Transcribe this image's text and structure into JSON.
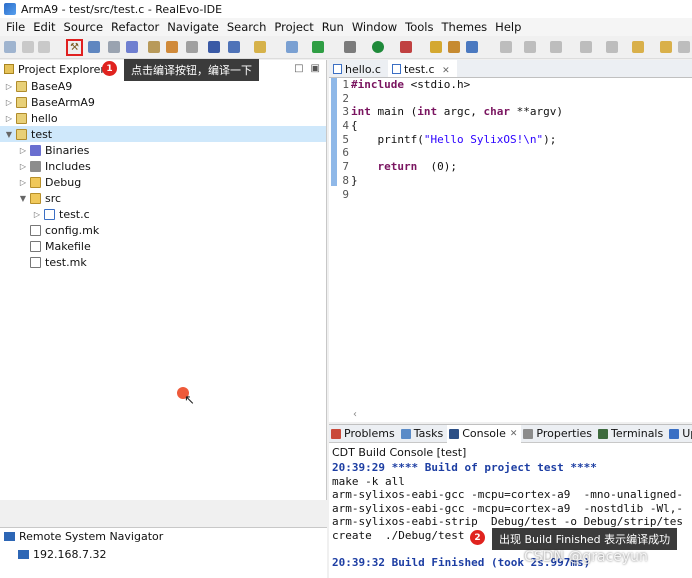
{
  "window": {
    "title": "ArmA9 - test/src/test.c - RealEvo-IDE"
  },
  "menu": [
    "File",
    "Edit",
    "Source",
    "Refactor",
    "Navigate",
    "Search",
    "Project",
    "Run",
    "Window",
    "Tools",
    "Themes",
    "Help"
  ],
  "annotations": {
    "step1": {
      "num": "1",
      "text": "点击编译按钮，编译一下"
    },
    "step2": {
      "num": "2",
      "text": "出现 Build Finished 表示编译成功"
    }
  },
  "explorer": {
    "title": "Project Explorer",
    "items": [
      {
        "label": "BaseA9",
        "icon": "project-icon"
      },
      {
        "label": "BaseArmA9",
        "icon": "project-icon"
      },
      {
        "label": "hello",
        "icon": "project-icon"
      },
      {
        "label": "test",
        "icon": "project-icon"
      },
      {
        "label": "Binaries",
        "icon": "binaries-icon"
      },
      {
        "label": "Includes",
        "icon": "includes-icon"
      },
      {
        "label": "Debug",
        "icon": "folder-icon"
      },
      {
        "label": "src",
        "icon": "folder-icon"
      },
      {
        "label": "test.c",
        "icon": "c-file-icon"
      },
      {
        "label": "config.mk",
        "icon": "file-icon"
      },
      {
        "label": "Makefile",
        "icon": "file-icon"
      },
      {
        "label": "test.mk",
        "icon": "file-icon"
      }
    ]
  },
  "remote": {
    "title": "Remote System Navigator",
    "host": "192.168.7.32"
  },
  "editor": {
    "tabs": [
      "hello.c",
      "test.c"
    ],
    "line_numbers": [
      "1",
      "2",
      "3",
      "4",
      "5",
      "6",
      "7",
      "8",
      "9"
    ],
    "code": {
      "l1_kw": "#include",
      "l1_rest": " <stdio.h>",
      "l3_kw1": "int",
      "l3_mid1": " main (",
      "l3_kw2": "int",
      "l3_mid2": " argc, ",
      "l3_kw3": "char",
      "l3_rest": " **argv)",
      "l4": "{",
      "l5_pre": "    printf(",
      "l5_str": "\"Hello SylixOS!\\n\"",
      "l5_post": ");",
      "l7_kw": "return",
      "l7_rest": "  (0);",
      "l8": "}"
    }
  },
  "bottom": {
    "tabs": [
      "Problems",
      "Tasks",
      "Console",
      "Properties",
      "Terminals",
      "Up"
    ],
    "console_title": "CDT Build Console [test]",
    "lines": [
      "20:39:29 **** Build of project test ****",
      "make -k all",
      "arm-sylixos-eabi-gcc -mcpu=cortex-a9  -mno-unaligned-",
      "arm-sylixos-eabi-gcc -mcpu=cortex-a9  -nostdlib -Wl,-",
      "arm-sylixos-eabi-strip  Debug/test -o Debug/strip/tes",
      "create  ./Debug/test",
      "",
      "20:39:32 Build Finished (took 2s.997ms)"
    ]
  },
  "watermark": "CSDN @graceyun"
}
